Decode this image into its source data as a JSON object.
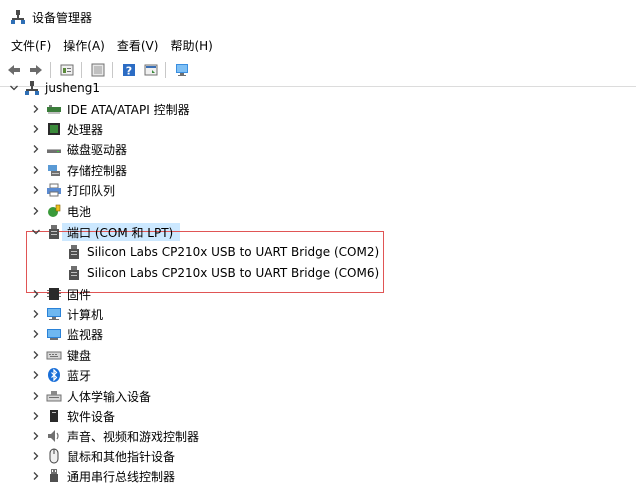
{
  "window": {
    "title": "设备管理器"
  },
  "menu": {
    "items": [
      "文件(F)",
      "操作(A)",
      "查看(V)",
      "帮助(H)"
    ]
  },
  "toolbar": {
    "buttons": [
      "back-icon",
      "forward-icon",
      "properties-icon",
      "show-hidden-icon",
      "help-icon",
      "action-icon",
      "monitor-icon"
    ]
  },
  "tree": {
    "root": "jusheng1",
    "categories": [
      {
        "label": "IDE ATA/ATAPI 控制器",
        "icon": "ide-controller-icon",
        "expanded": false
      },
      {
        "label": "处理器",
        "icon": "processor-icon",
        "expanded": false
      },
      {
        "label": "磁盘驱动器",
        "icon": "disk-drive-icon",
        "expanded": false
      },
      {
        "label": "存储控制器",
        "icon": "storage-controller-icon",
        "expanded": false
      },
      {
        "label": "打印队列",
        "icon": "printer-icon",
        "expanded": false
      },
      {
        "label": "电池",
        "icon": "battery-icon",
        "expanded": false
      },
      {
        "label": "端口 (COM 和 LPT)",
        "icon": "port-icon",
        "expanded": true,
        "children": [
          "Silicon Labs CP210x USB to UART Bridge (COM2)",
          "Silicon Labs CP210x USB to UART Bridge (COM6)"
        ]
      },
      {
        "label": "固件",
        "icon": "firmware-icon",
        "expanded": false
      },
      {
        "label": "计算机",
        "icon": "computer-icon",
        "expanded": false
      },
      {
        "label": "监视器",
        "icon": "monitor-icon",
        "expanded": false
      },
      {
        "label": "键盘",
        "icon": "keyboard-icon",
        "expanded": false
      },
      {
        "label": "蓝牙",
        "icon": "bluetooth-icon",
        "expanded": false
      },
      {
        "label": "人体学输入设备",
        "icon": "hid-icon",
        "expanded": false
      },
      {
        "label": "软件设备",
        "icon": "software-device-icon",
        "expanded": false
      },
      {
        "label": "声音、视频和游戏控制器",
        "icon": "audio-icon",
        "expanded": false
      },
      {
        "label": "鼠标和其他指针设备",
        "icon": "mouse-icon",
        "expanded": false
      },
      {
        "label": "通用串行总线控制器",
        "icon": "usb-icon",
        "expanded": false
      }
    ]
  },
  "colors": {
    "selection": "#cce8ff",
    "highlight_border": "#e05555"
  }
}
